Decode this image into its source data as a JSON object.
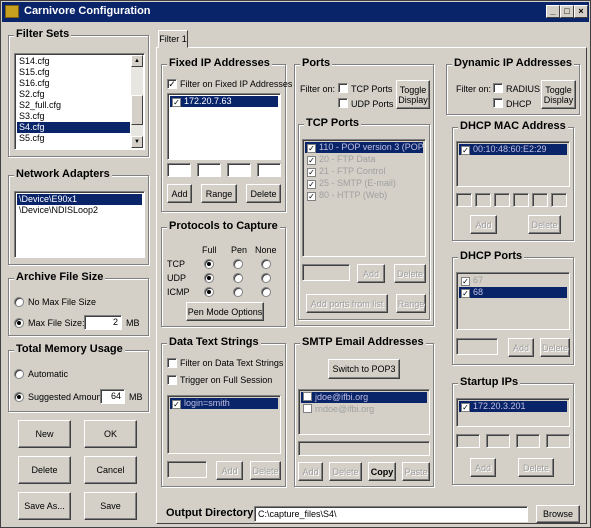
{
  "window": {
    "title": "Carnivore Configuration",
    "controls": [
      "_",
      "□",
      "×"
    ]
  },
  "tab": {
    "label": "Filter 1"
  },
  "filter_sets": {
    "title": "Filter Sets",
    "items": [
      "S14.cfg",
      "S15.cfg",
      "S16.cfg",
      "S2.cfg",
      "S2_full.cfg",
      "S3.cfg",
      "S4.cfg",
      "S5.cfg"
    ],
    "selected": "S4.cfg"
  },
  "network_adapters": {
    "title": "Network Adapters",
    "items": [
      "\\Device\\E90x1",
      "\\Device\\NDISLoop2"
    ],
    "selected": "\\Device\\E90x1"
  },
  "archive_file_size": {
    "title": "Archive File Size",
    "no_max_label": "No Max File Size",
    "max_label": "Max File Size:",
    "max_value": "2",
    "unit": "MB",
    "selected": "max"
  },
  "total_memory": {
    "title": "Total Memory Usage",
    "auto_label": "Automatic",
    "suggested_label": "Suggested Amount",
    "suggested_value": "64",
    "unit": "MB",
    "selected": "suggested"
  },
  "main_buttons": {
    "new": "New",
    "ok": "OK",
    "delete": "Delete",
    "cancel": "Cancel",
    "save_as": "Save As...",
    "save": "Save"
  },
  "fixed_ip": {
    "title": "Fixed IP Addresses",
    "filter_label": "Filter on Fixed IP Addresses",
    "filter_checked": true,
    "items": [
      {
        "label": "172.20.7.63",
        "checked": true
      }
    ],
    "add": "Add",
    "range": "Range",
    "delete": "Delete"
  },
  "protocols": {
    "title": "Protocols to Capture",
    "columns": [
      "Full",
      "Pen",
      "None"
    ],
    "rows": [
      {
        "name": "TCP",
        "selected": "Full"
      },
      {
        "name": "UDP",
        "selected": "Full"
      },
      {
        "name": "ICMP",
        "selected": "Full"
      }
    ],
    "pen_mode_button": "Pen Mode Options"
  },
  "data_text": {
    "title": "Data Text Strings",
    "filter_label": "Filter on Data Text Strings",
    "trigger_label": "Trigger on Full Session",
    "items": [
      {
        "label": "login=smith",
        "checked": true
      }
    ],
    "add": "Add",
    "delete": "Delete"
  },
  "ports": {
    "title": "Ports",
    "filter_on": "Filter on:",
    "tcp_label": "TCP Ports",
    "udp_label": "UDP Ports",
    "toggle": "Toggle Display"
  },
  "tcp_ports": {
    "title": "TCP Ports",
    "items": [
      {
        "label": "110 - POP version 3 (POP3)",
        "checked": true,
        "selected": true
      },
      {
        "label": "20 - FTP Data",
        "checked": true
      },
      {
        "label": "21 - FTP Control",
        "checked": true
      },
      {
        "label": "25 - SMTP (E-mail)",
        "checked": true
      },
      {
        "label": "80 - HTTP (Web)",
        "checked": true
      }
    ],
    "add": "Add",
    "delete": "Delete",
    "add_ports_from_list": "Add ports from list",
    "range": "Range"
  },
  "smtp": {
    "title": "SMTP Email Addresses",
    "switch_button": "Switch to POP3",
    "items": [
      {
        "label": "jdoe@ifbi.org",
        "selected": true
      },
      {
        "label": "rndoe@ifbi.org",
        "selected": false
      }
    ],
    "add": "Add",
    "delete": "Delete",
    "copy": "Copy",
    "paste": "Paste"
  },
  "dynamic_ip": {
    "title": "Dynamic IP Addresses",
    "filter_on": "Filter on:",
    "radius_label": "RADIUS",
    "dhcp_label": "DHCP",
    "toggle": "Toggle Display"
  },
  "dhcp_mac": {
    "title": "DHCP MAC Address",
    "items": [
      {
        "label": "00:10:48:60:E2:29",
        "checked": true
      }
    ],
    "add": "Add",
    "delete": "Delete"
  },
  "dhcp_ports": {
    "title": "DHCP Ports",
    "items": [
      {
        "label": "67",
        "checked": true,
        "selected": false
      },
      {
        "label": "68",
        "checked": true,
        "selected": true
      }
    ],
    "add": "Add",
    "delete": "Delete"
  },
  "startup_ips": {
    "title": "Startup IPs",
    "items": [
      {
        "label": "172.20.3.201",
        "checked": true
      }
    ],
    "add": "Add",
    "delete": "Delete"
  },
  "output": {
    "label": "Output Directory:",
    "value": "C:\\capture_files\\S4\\",
    "browse": "Browse"
  }
}
